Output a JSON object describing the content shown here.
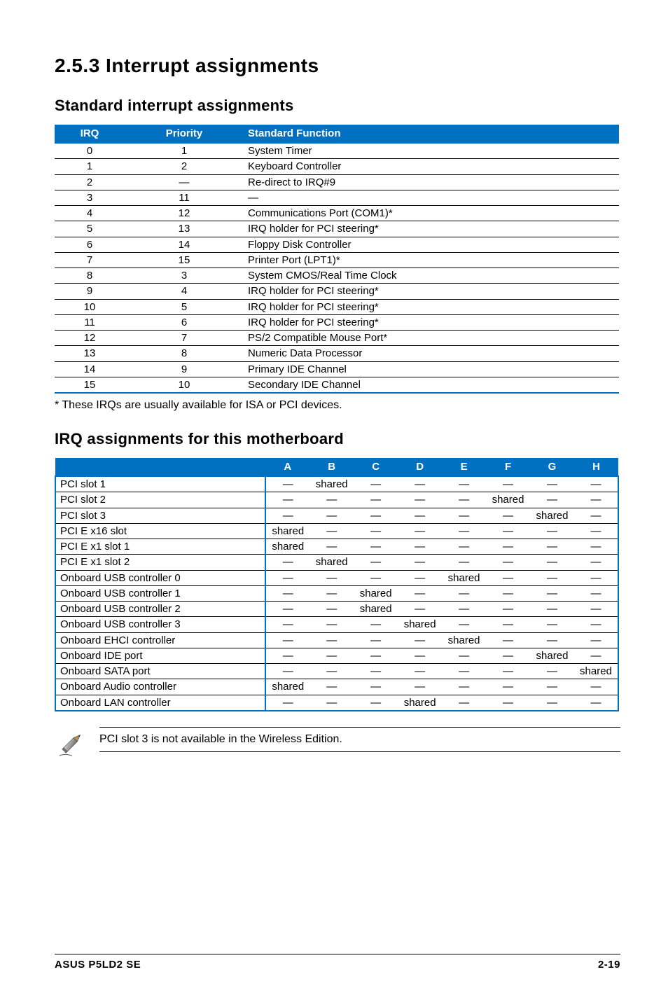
{
  "heading": "2.5.3   Interrupt assignments",
  "sub1": "Standard interrupt assignments",
  "table1": {
    "headers": {
      "irq": "IRQ",
      "priority": "Priority",
      "func": "Standard Function"
    },
    "rows": [
      {
        "irq": "0",
        "pri": "1",
        "func": "System Timer"
      },
      {
        "irq": "1",
        "pri": "2",
        "func": "Keyboard Controller"
      },
      {
        "irq": "2",
        "pri": "—",
        "func": "Re-direct to IRQ#9"
      },
      {
        "irq": "3",
        "pri": "11",
        "func": "—"
      },
      {
        "irq": "4",
        "pri": "12",
        "func": "Communications Port (COM1)*"
      },
      {
        "irq": "5",
        "pri": "13",
        "func": "IRQ holder for PCI steering*"
      },
      {
        "irq": "6",
        "pri": "14",
        "func": "Floppy Disk Controller"
      },
      {
        "irq": "7",
        "pri": "15",
        "func": "Printer Port (LPT1)*"
      },
      {
        "irq": "8",
        "pri": "3",
        "func": "System CMOS/Real Time Clock"
      },
      {
        "irq": "9",
        "pri": "4",
        "func": "IRQ holder for PCI steering*"
      },
      {
        "irq": "10",
        "pri": "5",
        "func": "IRQ holder for PCI steering*"
      },
      {
        "irq": "11",
        "pri": "6",
        "func": "IRQ holder for PCI steering*"
      },
      {
        "irq": "12",
        "pri": "7",
        "func": "PS/2 Compatible Mouse Port*"
      },
      {
        "irq": "13",
        "pri": "8",
        "func": "Numeric Data Processor"
      },
      {
        "irq": "14",
        "pri": "9",
        "func": "Primary IDE Channel"
      },
      {
        "irq": "15",
        "pri": "10",
        "func": "Secondary IDE Channel"
      }
    ]
  },
  "note_star": "* These IRQs are usually available for ISA or PCI devices.",
  "sub2": "IRQ assignments for this motherboard",
  "table2": {
    "cols": [
      "A",
      "B",
      "C",
      "D",
      "E",
      "F",
      "G",
      "H"
    ],
    "rows": [
      {
        "name": "PCI slot 1",
        "v": [
          "—",
          "shared",
          "—",
          "—",
          "—",
          "—",
          "—",
          "—"
        ]
      },
      {
        "name": "PCI slot 2",
        "v": [
          "—",
          "—",
          "—",
          "—",
          "—",
          "shared",
          "—",
          "—"
        ]
      },
      {
        "name": "PCI slot 3",
        "v": [
          "—",
          "—",
          "—",
          "—",
          "—",
          "—",
          "shared",
          "—"
        ]
      },
      {
        "name": "PCI E x16 slot",
        "v": [
          "shared",
          "—",
          "—",
          "—",
          "—",
          "—",
          "—",
          "—"
        ]
      },
      {
        "name": "PCI E x1 slot 1",
        "v": [
          "shared",
          "—",
          "—",
          "—",
          "—",
          "—",
          "—",
          "—"
        ]
      },
      {
        "name": "PCI E x1 slot 2",
        "v": [
          "—",
          "shared",
          "—",
          "—",
          "—",
          "—",
          "—",
          "—"
        ]
      },
      {
        "name": "Onboard USB controller 0",
        "v": [
          "—",
          "—",
          "—",
          "—",
          "shared",
          "—",
          "—",
          "—"
        ]
      },
      {
        "name": "Onboard USB controller 1",
        "v": [
          "—",
          "—",
          "shared",
          "—",
          "—",
          "—",
          "—",
          "—"
        ]
      },
      {
        "name": "Onboard USB controller 2",
        "v": [
          "—",
          "—",
          "shared",
          "—",
          "—",
          "—",
          "—",
          "—"
        ]
      },
      {
        "name": "Onboard USB controller 3",
        "v": [
          "—",
          "—",
          "—",
          "shared",
          "—",
          "—",
          "—",
          "—"
        ]
      },
      {
        "name": "Onboard EHCI controller",
        "v": [
          "—",
          "—",
          "—",
          "—",
          "shared",
          "—",
          "—",
          "—"
        ]
      },
      {
        "name": "Onboard IDE port",
        "v": [
          "—",
          "—",
          "—",
          "—",
          "—",
          "—",
          "shared",
          "—"
        ]
      },
      {
        "name": "Onboard SATA port",
        "v": [
          "—",
          "—",
          "—",
          "—",
          "—",
          "—",
          "—",
          "shared"
        ]
      },
      {
        "name": "Onboard Audio controller",
        "v": [
          "shared",
          "—",
          "—",
          "—",
          "—",
          "—",
          "—",
          "—"
        ]
      },
      {
        "name": "Onboard LAN controller",
        "v": [
          "—",
          "—",
          "—",
          "shared",
          "—",
          "—",
          "—",
          "—"
        ]
      }
    ]
  },
  "callout_text": "PCI slot 3 is not available in the Wireless Edition.",
  "footer": {
    "left": "ASUS P5LD2 SE",
    "right": "2-19"
  }
}
